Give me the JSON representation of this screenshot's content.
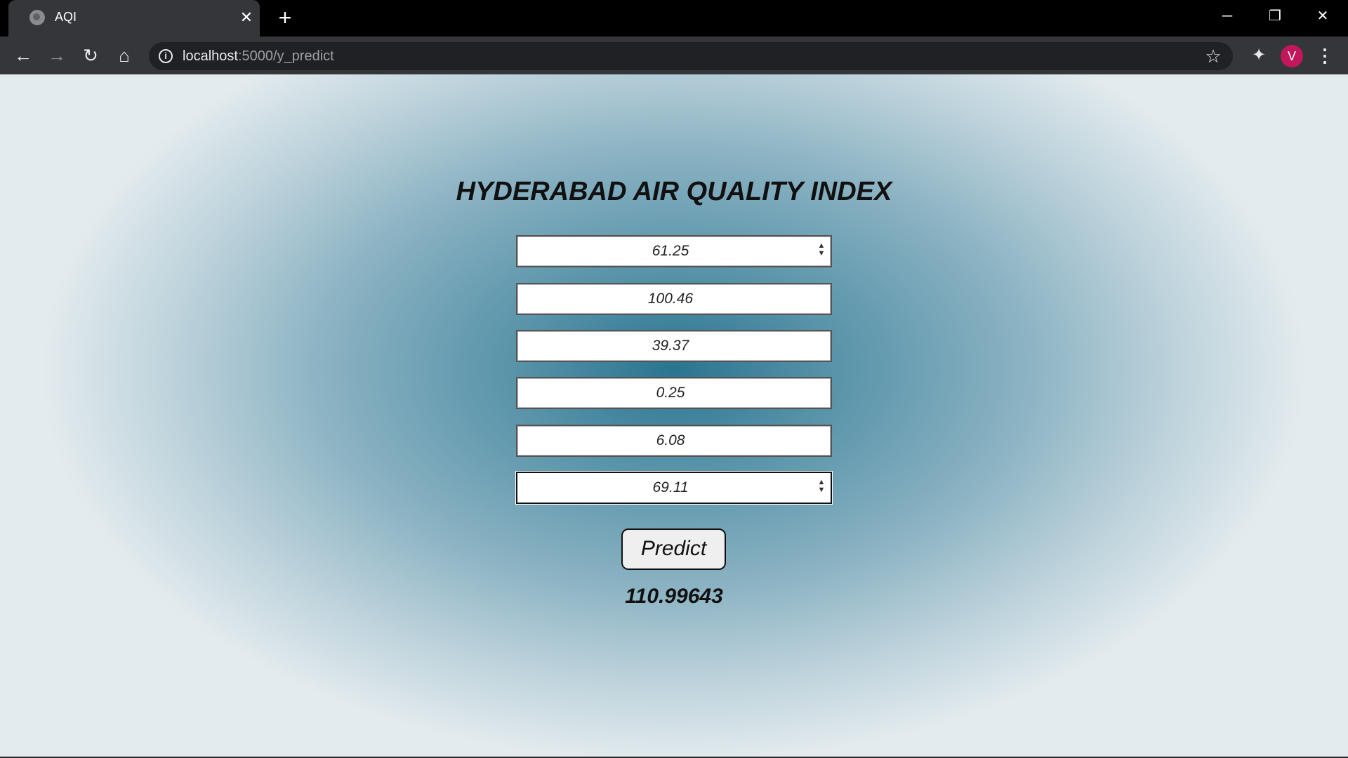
{
  "browser": {
    "tab_title": "AQI",
    "url_host": "localhost",
    "url_path": ":5000/y_predict",
    "profile_initial": "V",
    "profile_color": "#c2185b"
  },
  "page": {
    "title": "HYDERABAD AIR QUALITY INDEX",
    "fields": [
      {
        "value": "61.25"
      },
      {
        "value": "100.46"
      },
      {
        "value": "39.37"
      },
      {
        "value": "0.25"
      },
      {
        "value": "6.08"
      },
      {
        "value": "69.11"
      }
    ],
    "predict_label": "Predict",
    "result": "110.99643"
  },
  "icons": {
    "back": "back-arrow-icon",
    "forward": "forward-arrow-icon",
    "reload": "reload-icon",
    "home": "home-icon",
    "info": "info-icon",
    "bookmark": "star-icon",
    "extensions": "puzzle-icon",
    "menu": "kebab-menu-icon"
  }
}
